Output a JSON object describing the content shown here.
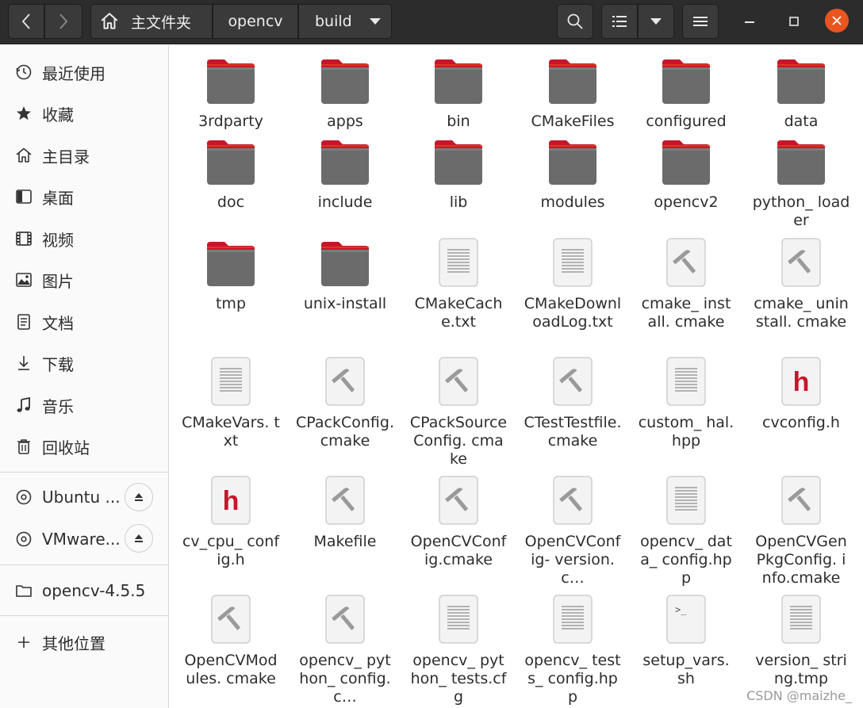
{
  "header": {
    "breadcrumbs": [
      {
        "label": "主文件夹",
        "icon": "home-icon"
      },
      {
        "label": "opencv"
      },
      {
        "label": "build"
      }
    ]
  },
  "sidebar": {
    "places": [
      {
        "label": "最近使用",
        "icon": "recent-icon"
      },
      {
        "label": "收藏",
        "icon": "star-icon"
      },
      {
        "label": "主目录",
        "icon": "home-icon"
      },
      {
        "label": "桌面",
        "icon": "desktop-icon"
      },
      {
        "label": "视频",
        "icon": "video-icon"
      },
      {
        "label": "图片",
        "icon": "picture-icon"
      },
      {
        "label": "文档",
        "icon": "document-icon"
      },
      {
        "label": "下载",
        "icon": "download-icon"
      },
      {
        "label": "音乐",
        "icon": "music-icon"
      },
      {
        "label": "回收站",
        "icon": "trash-icon"
      }
    ],
    "devices": [
      {
        "label": "Ubuntu ...",
        "icon": "disc-icon"
      },
      {
        "label": "VMware...",
        "icon": "disc-icon"
      }
    ],
    "bookmarks": [
      {
        "label": "opencv-4.5.5",
        "icon": "folder-icon"
      }
    ],
    "other_locations": {
      "label": "其他位置",
      "icon": "plus-icon"
    }
  },
  "files": [
    {
      "name": "3rdparty",
      "type": "folder"
    },
    {
      "name": "apps",
      "type": "folder"
    },
    {
      "name": "bin",
      "type": "folder"
    },
    {
      "name": "CMakeFiles",
      "type": "folder"
    },
    {
      "name": "configured",
      "type": "folder"
    },
    {
      "name": "data",
      "type": "folder"
    },
    {
      "name": "doc",
      "type": "folder"
    },
    {
      "name": "include",
      "type": "folder"
    },
    {
      "name": "lib",
      "type": "folder"
    },
    {
      "name": "modules",
      "type": "folder"
    },
    {
      "name": "opencv2",
      "type": "folder"
    },
    {
      "name": "python_ loader",
      "type": "folder"
    },
    {
      "name": "tmp",
      "type": "folder"
    },
    {
      "name": "unix-install",
      "type": "folder"
    },
    {
      "name": "CMakeCache.txt",
      "type": "text"
    },
    {
      "name": "CMakeDownloadLog.txt",
      "type": "text"
    },
    {
      "name": "cmake_ install. cmake",
      "type": "cmake"
    },
    {
      "name": "cmake_ uninstall. cmake",
      "type": "cmake"
    },
    {
      "name": "CMakeVars. txt",
      "type": "text"
    },
    {
      "name": "CPackConfig.cmake",
      "type": "cmake"
    },
    {
      "name": "CPackSourceConfig. cmake",
      "type": "cmake"
    },
    {
      "name": "CTestTestfile.cmake",
      "type": "cmake"
    },
    {
      "name": "custom_ hal.hpp",
      "type": "text"
    },
    {
      "name": "cvconfig.h",
      "type": "header"
    },
    {
      "name": "cv_cpu_ config.h",
      "type": "header"
    },
    {
      "name": "Makefile",
      "type": "cmake"
    },
    {
      "name": "OpenCVConfig.cmake",
      "type": "cmake"
    },
    {
      "name": "OpenCVConfig- version.c…",
      "type": "cmake"
    },
    {
      "name": "opencv_ data_ config.hpp",
      "type": "text"
    },
    {
      "name": "OpenCVGenPkgConfig. info.cmake",
      "type": "cmake"
    },
    {
      "name": "OpenCVModules. cmake",
      "type": "cmake"
    },
    {
      "name": "opencv_ python_ config.c…",
      "type": "cmake"
    },
    {
      "name": "opencv_ python_ tests.cfg",
      "type": "text"
    },
    {
      "name": "opencv_ tests_ config.hpp",
      "type": "text"
    },
    {
      "name": "setup_vars. sh",
      "type": "script"
    },
    {
      "name": "version_ string.tmp",
      "type": "text"
    }
  ],
  "watermark": "CSDN @maizhe_",
  "colors": {
    "folder_tab": "#c7162b",
    "folder_body": "#6b6b6b",
    "close": "#e95420",
    "header_h": "#c7162b"
  }
}
